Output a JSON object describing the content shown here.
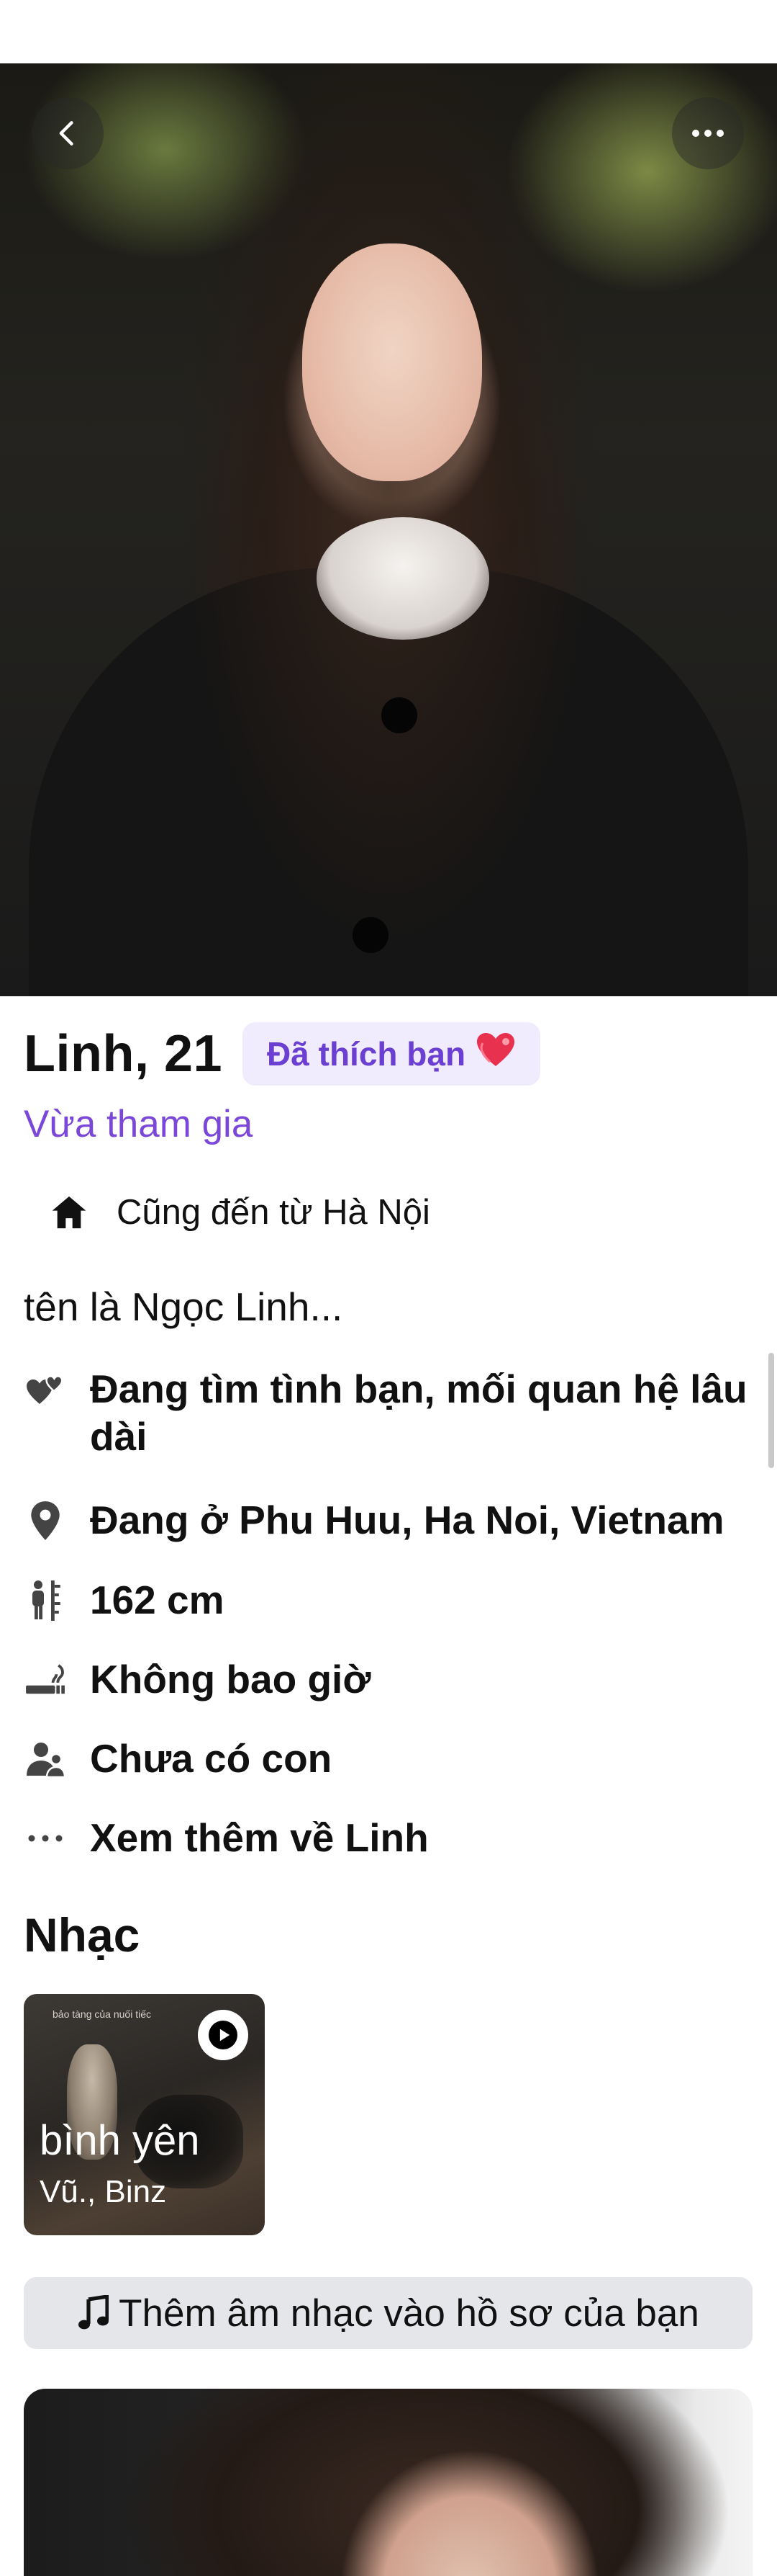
{
  "header": {
    "back_icon": "chevron-left-icon",
    "more_icon": "more-horizontal-icon"
  },
  "profile": {
    "name_age": "Linh, 21",
    "liked_badge": "Đã thích bạn",
    "liked_badge_emoji": "❤",
    "joined": "Vừa tham gia",
    "hometown": "Cũng đến từ Hà Nội",
    "bio": "tên là Ngọc Linh..."
  },
  "details": [
    {
      "icon": "hearts-icon",
      "text": "Đang tìm tình bạn, mối quan hệ lâu dài"
    },
    {
      "icon": "location-pin-icon",
      "text": "Đang ở Phu Huu, Ha Noi, Vietnam"
    },
    {
      "icon": "height-ruler-icon",
      "text": "162 cm"
    },
    {
      "icon": "smoking-icon",
      "text": "Không bao giờ"
    },
    {
      "icon": "children-icon",
      "text": "Chưa có con"
    },
    {
      "icon": "dots-icon",
      "text": "Xem thêm về Linh"
    }
  ],
  "music": {
    "section_title": "Nhạc",
    "song_title": "bình yên",
    "song_artist": "Vũ., Binz",
    "cover_text": "bảo tàng của nuối tiếc",
    "add_music_label": "Thêm âm nhạc vào hồ sơ của bạn"
  },
  "colors": {
    "accent_purple": "#7a47d8",
    "badge_bg": "#f0ecfd",
    "button_gray": "#e4e6ea"
  }
}
